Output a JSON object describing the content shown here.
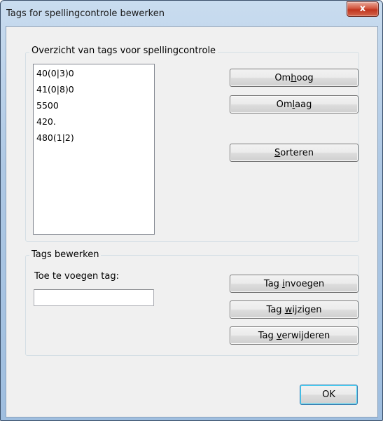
{
  "window": {
    "title": "Tags for spellingcontrole bewerken",
    "close_symbol": "x"
  },
  "overview": {
    "legend": "Overzicht van tags voor spellingcontrole",
    "tags": [
      "40(0|3)0",
      "41(0|8)0",
      "5500",
      "420.",
      "480(1|2)"
    ],
    "up_button": {
      "before": "Om",
      "accel": "h",
      "after": "oog"
    },
    "down_button": {
      "before": "Om",
      "accel": "l",
      "after": "aag"
    },
    "sort_button": {
      "before": "",
      "accel": "S",
      "after": "orteren"
    }
  },
  "edit": {
    "legend": "Tags bewerken",
    "add_label": "Toe te voegen tag:",
    "add_value": "",
    "insert_button": {
      "before": "Tag ",
      "accel": "i",
      "after": "nvoegen"
    },
    "change_button": {
      "before": "Tag ",
      "accel": "w",
      "after": "ijzigen"
    },
    "delete_button": {
      "before": "Tag ",
      "accel": "v",
      "after": "erwijderen"
    }
  },
  "ok_button": "OK"
}
